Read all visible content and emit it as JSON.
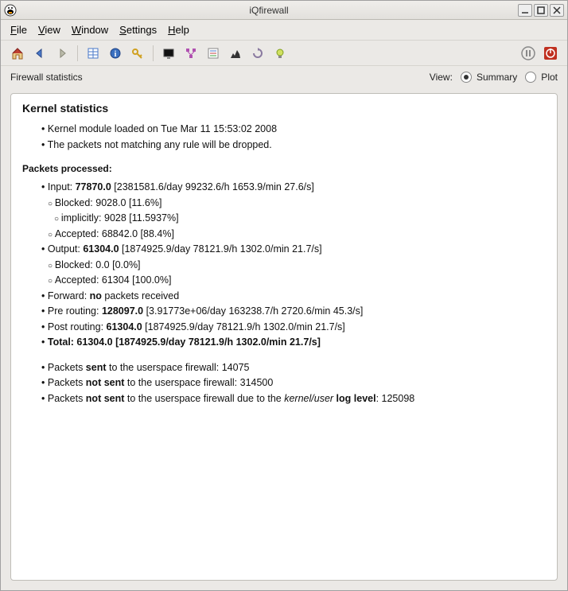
{
  "window": {
    "title": "iQfirewall"
  },
  "menu": {
    "file": "File",
    "view": "View",
    "window": "Window",
    "settings": "Settings",
    "help": "Help"
  },
  "toolbar": {
    "home": "home-icon",
    "back": "back-icon",
    "forward": "forward-icon",
    "table": "table-icon",
    "info": "info-icon",
    "key": "key-icon",
    "monitor": "monitor-icon",
    "network": "network-icon",
    "list": "list-icon",
    "chart": "chart-icon",
    "reload": "reload-icon",
    "bulb": "bulb-icon",
    "pause": "pause-icon",
    "power": "power-icon"
  },
  "viewbar": {
    "label": "Firewall statistics",
    "view_label": "View:",
    "summary": "Summary",
    "plot": "Plot"
  },
  "stats": {
    "heading": "Kernel statistics",
    "kernel_loaded": "Kernel module loaded on Tue Mar 11 15:53:02 2008",
    "not_matching": "The packets not matching any rule will be dropped.",
    "packets_processed_label": "Packets processed:",
    "input_prefix": "Input: ",
    "input_value": "77870.0",
    "input_rates": " [2381581.6/day 99232.6/h 1653.9/min 27.6/s]",
    "input_blocked": "Blocked: 9028.0 [11.6%]",
    "input_implicitly": "implicitly: 9028 [11.5937%]",
    "input_accepted": "Accepted: 68842.0 [88.4%]",
    "output_prefix": "Output: ",
    "output_value": "61304.0",
    "output_rates": " [1874925.9/day 78121.9/h 1302.0/min 21.7/s]",
    "output_blocked": "Blocked: 0.0 [0.0%]",
    "output_accepted": "Accepted: 61304 [100.0%]",
    "forward_prefix": "Forward: ",
    "forward_value": "no",
    "forward_suffix": " packets received",
    "prerouting_prefix": "Pre routing: ",
    "prerouting_value": "128097.0",
    "prerouting_rates": " [3.91773e+06/day 163238.7/h 2720.6/min 45.3/s]",
    "postrouting_prefix": "Post routing: ",
    "postrouting_value": "61304.0",
    "postrouting_rates": " [1874925.9/day 78121.9/h 1302.0/min 21.7/s]",
    "total": "Total: 61304.0 [1874925.9/day 78121.9/h 1302.0/min 21.7/s]",
    "sent_prefix": "Packets ",
    "sent_bold": "sent",
    "sent_suffix": " to the userspace firewall: 14075",
    "notsent1_prefix": "Packets ",
    "notsent1_bold": "not sent",
    "notsent1_suffix": " to the userspace firewall: 314500",
    "notsent2_prefix": "Packets ",
    "notsent2_bold": "not sent",
    "notsent2_mid": " to the userspace firewall due to the ",
    "notsent2_italic": "kernel/user",
    "notsent2_mid2": " ",
    "notsent2_bold2": "log level",
    "notsent2_suffix": ": 125098"
  }
}
